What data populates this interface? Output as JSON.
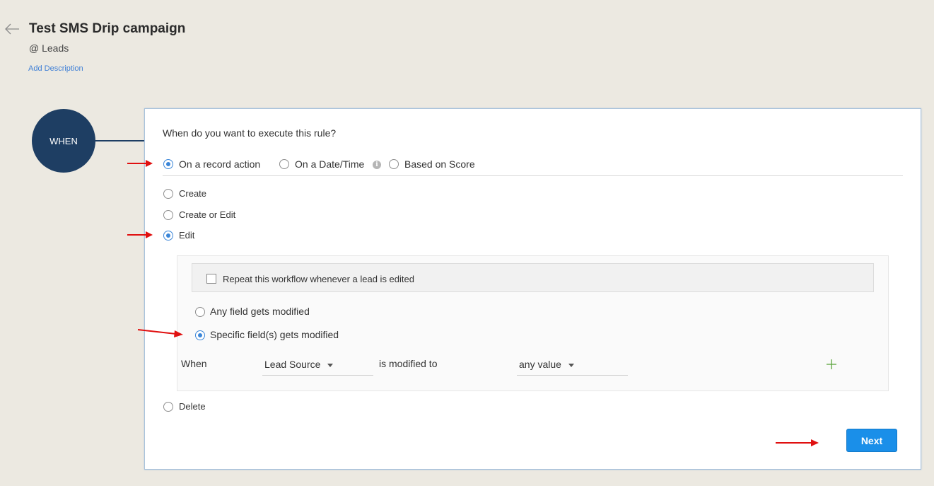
{
  "header": {
    "title": "Test SMS Drip campaign",
    "module": "@  Leads",
    "add_description": "Add Description"
  },
  "step": {
    "label": "WHEN"
  },
  "card": {
    "question": "When do you want to execute this rule?",
    "trigger_options": [
      {
        "label": "On a record action",
        "selected": true
      },
      {
        "label": "On a Date/Time",
        "selected": false
      },
      {
        "label": "Based on Score",
        "selected": false
      }
    ],
    "info_glyph": "i",
    "record_actions": [
      {
        "label": "Create",
        "selected": false
      },
      {
        "label": "Create or Edit",
        "selected": false
      },
      {
        "label": "Edit",
        "selected": true
      },
      {
        "label": "Delete",
        "selected": false
      }
    ],
    "edit_panel": {
      "repeat_label": "Repeat this workflow whenever a lead is edited",
      "repeat_checked": false,
      "modify_options": [
        {
          "label": "Any field gets modified",
          "selected": false
        },
        {
          "label": "Specific field(s) gets modified",
          "selected": true
        }
      ],
      "condition": {
        "when_label": "When",
        "field_value": "Lead Source",
        "operator_label": "is modified to",
        "value": "any value"
      }
    },
    "next_label": "Next"
  },
  "colors": {
    "accent": "#1a8fe9",
    "step_circle": "#1e3e63",
    "annotation_arrow": "#e01010",
    "plus": "#5aa33c"
  }
}
